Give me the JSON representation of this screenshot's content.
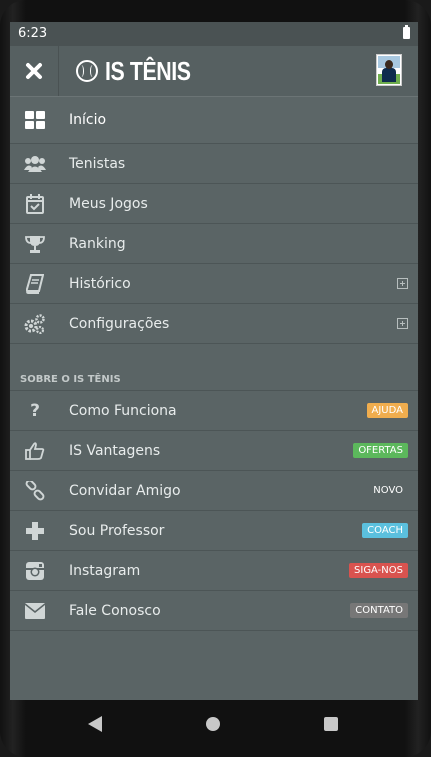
{
  "status_bar": {
    "time": "6:23"
  },
  "header": {
    "app_title": "IS TÊNIS"
  },
  "menu": {
    "primary": [
      {
        "label": "Início",
        "icon": "dashboard-icon"
      },
      {
        "label": "Tenistas",
        "icon": "users-icon"
      },
      {
        "label": "Meus Jogos",
        "icon": "calendar-check-icon"
      },
      {
        "label": "Ranking",
        "icon": "trophy-icon"
      },
      {
        "label": "Histórico",
        "icon": "book-icon",
        "expandable": true
      },
      {
        "label": "Configurações",
        "icon": "cogs-icon",
        "expandable": true
      }
    ],
    "section_title": "SOBRE O IS TÊNIS",
    "secondary": [
      {
        "label": "Como Funciona",
        "icon": "question-icon",
        "badge": "AJUDA",
        "badge_color": "#f0ad4e"
      },
      {
        "label": "IS Vantagens",
        "icon": "thumbs-up-icon",
        "badge": "OFERTAS",
        "badge_color": "#5cb85c"
      },
      {
        "label": "Convidar Amigo",
        "icon": "link-icon",
        "badge": "NOVO",
        "badge_color": "transparent"
      },
      {
        "label": "Sou Professor",
        "icon": "plus-icon",
        "badge": "COACH",
        "badge_color": "#5bc0de"
      },
      {
        "label": "Instagram",
        "icon": "instagram-icon",
        "badge": "SIGA-NOS",
        "badge_color": "#d9534f"
      },
      {
        "label": "Fale Conosco",
        "icon": "envelope-icon",
        "badge": "CONTATO",
        "badge_color": "#777777"
      }
    ]
  },
  "colors": {
    "drawer_background": "#5a6465",
    "divider": "#4c5556",
    "text": "#e8ecec"
  }
}
